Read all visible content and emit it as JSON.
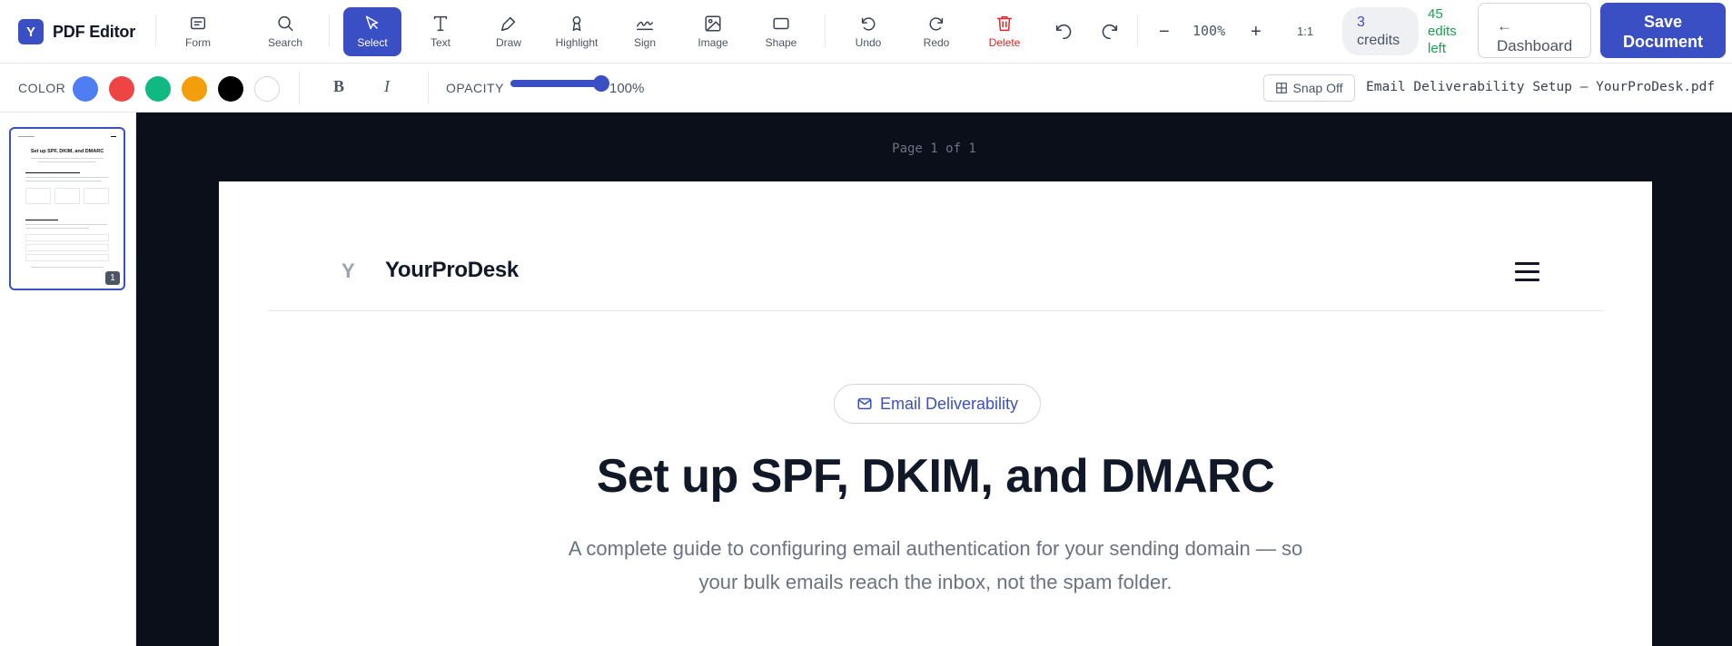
{
  "app": {
    "name": "PDF Editor",
    "logo_letter": "Y"
  },
  "tools": [
    {
      "id": "form",
      "label": "Form",
      "icon": "form-icon"
    },
    {
      "id": "search",
      "label": "Search",
      "icon": "search-icon"
    },
    {
      "id": "select",
      "label": "Select",
      "icon": "cursor-icon",
      "active": true
    },
    {
      "id": "text",
      "label": "Text",
      "icon": "text-icon"
    },
    {
      "id": "draw",
      "label": "Draw",
      "icon": "pen-icon"
    },
    {
      "id": "highlight",
      "label": "Highlight",
      "icon": "highlighter-icon"
    },
    {
      "id": "sign",
      "label": "Sign",
      "icon": "signature-icon"
    },
    {
      "id": "image",
      "label": "Image",
      "icon": "image-icon"
    },
    {
      "id": "shape",
      "label": "Shape",
      "icon": "rectangle-icon"
    },
    {
      "id": "undo",
      "label": "Undo",
      "icon": "undo-icon"
    },
    {
      "id": "redo",
      "label": "Redo",
      "icon": "redo-icon"
    },
    {
      "id": "delete",
      "label": "Delete",
      "icon": "trash-icon"
    }
  ],
  "zoom": {
    "minus": "−",
    "value": "100%",
    "plus": "+",
    "reset": "1:1"
  },
  "account": {
    "credits_count": "3",
    "credits_label": "credits",
    "edits_line1": "45",
    "edits_line2": "edits",
    "edits_line3": "left",
    "dashboard_arrow": "←",
    "dashboard_label": "Dashboard",
    "save_line1": "Save",
    "save_line2": "Document"
  },
  "format": {
    "color_label": "COLOR",
    "colors": [
      "#4f7df3",
      "#ef4444",
      "#10b981",
      "#f59e0b",
      "#000000",
      "#ffffff"
    ],
    "bold_label": "B",
    "italic_label": "I",
    "opacity_label": "OPACITY",
    "opacity_value": "100%",
    "opacity_fraction": 1.0,
    "snap_label": "Snap Off",
    "file_name": "Email Deliverability Setup — YourProDesk.pdf"
  },
  "thumbnails": [
    {
      "page": "1",
      "active": true
    }
  ],
  "viewer": {
    "page_indicator": "Page 1 of 1"
  },
  "document": {
    "logo_letter": "Y",
    "brand": "YourProDesk",
    "badge": "Email Deliverability",
    "title": "Set up SPF, DKIM, and DMARC",
    "subtitle_line1": "A complete guide to configuring email authentication for your sending domain — so",
    "subtitle_line2": "your bulk emails reach the inbox, not the spam folder."
  },
  "colors": {
    "accent": "#3b4fc4",
    "danger": "#dc2626",
    "success": "#16a34a",
    "canvas_bg": "#0b0f1a"
  }
}
